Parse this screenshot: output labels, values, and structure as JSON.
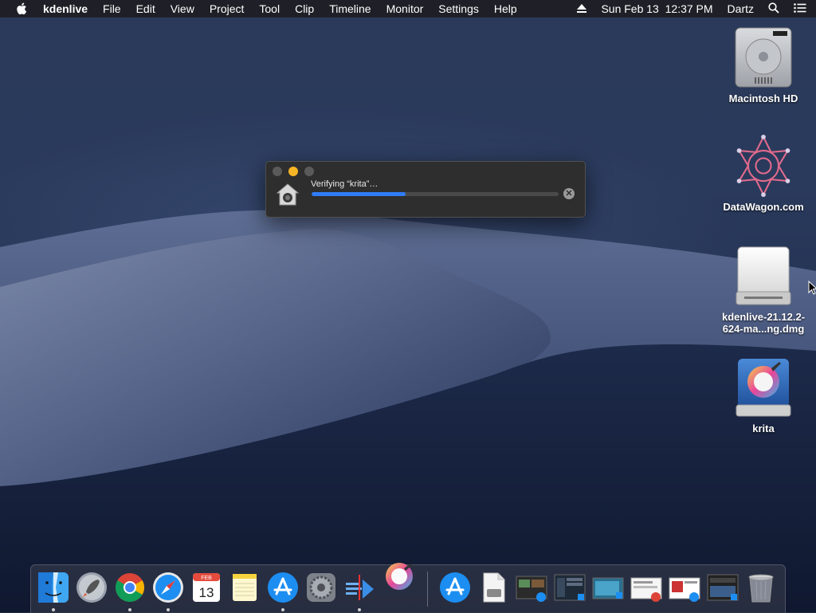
{
  "menubar": {
    "app_name": "kdenlive",
    "items": [
      "File",
      "Edit",
      "View",
      "Project",
      "Tool",
      "Clip",
      "Timeline",
      "Monitor",
      "Settings",
      "Help"
    ],
    "datetime": "Sun Feb 13  12:37 PM",
    "user": "Dartz",
    "icons": [
      "apple-icon",
      "eject-icon",
      "spotlight-search-icon",
      "notification-center-icon"
    ]
  },
  "desktop_icons": [
    {
      "label": "Macintosh HD",
      "icon": "hard-drive-icon"
    },
    {
      "label": "DataWagon.com",
      "icon": "datawagon-logo-icon"
    },
    {
      "label": "kdenlive-21.12.2-624-ma...ng.dmg",
      "label_line1": "kdenlive-21.12.2-",
      "label_line2": "624-ma...ng.dmg",
      "icon": "disk-image-icon"
    },
    {
      "label": "krita",
      "icon": "krita-volume-icon"
    }
  ],
  "dialog": {
    "message": "Verifying “krita”…",
    "progress": 0.38,
    "accent": "#2f7cf6"
  },
  "dock": {
    "apps": [
      "Finder",
      "Launchpad",
      "Google Chrome",
      "Safari",
      "Calendar",
      "Notes",
      "App Store",
      "System Preferences",
      "Kdenlive",
      "Krita"
    ],
    "calendar_month": "FEB",
    "calendar_day": "13",
    "recent": [
      "App Store",
      "Document",
      "Screenshot 1",
      "Screenshot 2",
      "Screenshot 3",
      "Screenshot 4",
      "Screenshot 5",
      "Screenshot 6",
      "Trash"
    ]
  }
}
